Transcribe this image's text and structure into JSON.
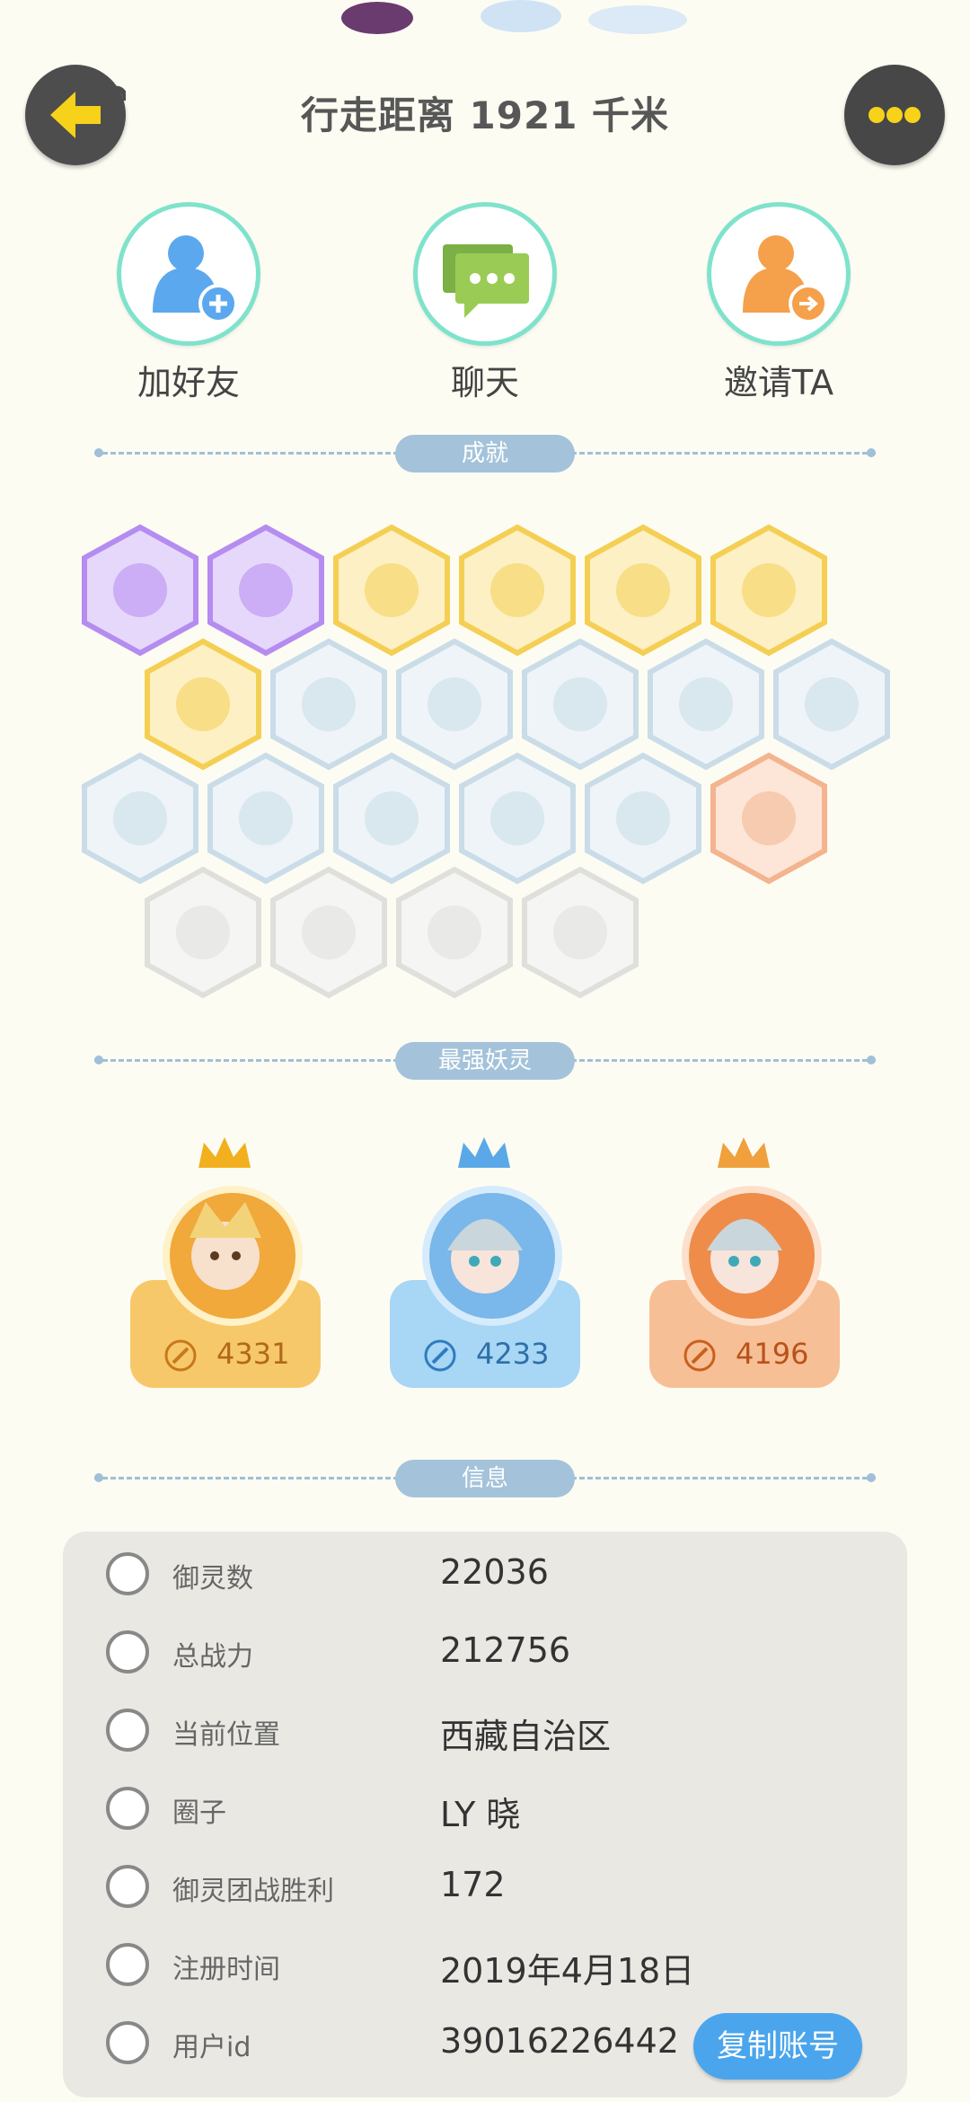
{
  "header": {
    "title": "行走距离 1921 千米"
  },
  "actions": [
    {
      "label": "加好友",
      "icon": "add-friend-icon"
    },
    {
      "label": "聊天",
      "icon": "chat-icon"
    },
    {
      "label": "邀请TA",
      "icon": "invite-icon"
    }
  ],
  "sections": {
    "achievements": "成就",
    "strongest": "最强妖灵",
    "info": "信息"
  },
  "pets": [
    {
      "power": "4331",
      "rank_color": "#f7c86a"
    },
    {
      "power": "4233",
      "rank_color": "#a8d6f5"
    },
    {
      "power": "4196",
      "rank_color": "#f7bf96"
    }
  ],
  "info": [
    {
      "label": "御灵数",
      "value": "22036",
      "icon": "spirit-count-icon"
    },
    {
      "label": "总战力",
      "value": "212756",
      "icon": "sword-icon"
    },
    {
      "label": "当前位置",
      "value": "西藏自治区",
      "icon": "location-pin-icon"
    },
    {
      "label": "圈子",
      "value": "LY 晓",
      "icon": "circle-icon"
    },
    {
      "label": "御灵团战胜利",
      "value": "172",
      "icon": "tower-icon"
    },
    {
      "label": "注册时间",
      "value": "2019年4月18日",
      "icon": "clock-icon"
    },
    {
      "label": "用户id",
      "value": "39016226442",
      "icon": "id-card-icon"
    }
  ],
  "copy_button": "复制账号",
  "colors": {
    "background": "#fdfcf3",
    "divider": "#9fc0d8",
    "accent_blue": "#4aa5ec"
  }
}
